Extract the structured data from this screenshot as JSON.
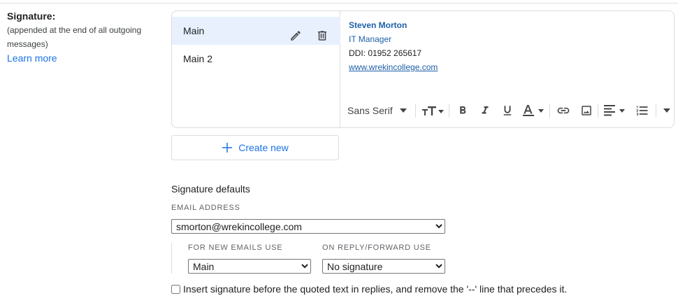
{
  "signature_section": {
    "title": "Signature:",
    "description": "(appended at the end of all outgoing messages)",
    "learn_more": "Learn more"
  },
  "signatures": {
    "items": [
      {
        "label": "Main",
        "selected": true
      },
      {
        "label": "Main 2",
        "selected": false
      }
    ],
    "create_new_label": "Create new"
  },
  "signature_content": {
    "name": "Steven Morton",
    "role": "IT Manager",
    "ddi": "DDI: 01952 265617",
    "website": "www.wrekincollege.com",
    "text_color": "#1d5fa8"
  },
  "toolbar": {
    "font_family": "Sans Serif",
    "buttons": [
      "text-size",
      "bold",
      "italic",
      "underline",
      "text-color",
      "link",
      "image",
      "align",
      "numbered-list",
      "more-formatting"
    ]
  },
  "defaults": {
    "title": "Signature defaults",
    "email_label": "EMAIL ADDRESS",
    "email_value": "smorton@wrekincollege.com",
    "new_emails_label": "FOR NEW EMAILS USE",
    "new_emails_value": "Main",
    "reply_label": "ON REPLY/FORWARD USE",
    "reply_value": "No signature",
    "checkbox_label": "Insert signature before the quoted text in replies, and remove the '--' line that precedes it.",
    "checkbox_checked": false
  },
  "colors": {
    "accent": "#1a73e8",
    "selected_bg": "#e8f0fe",
    "border": "#dadce0"
  }
}
